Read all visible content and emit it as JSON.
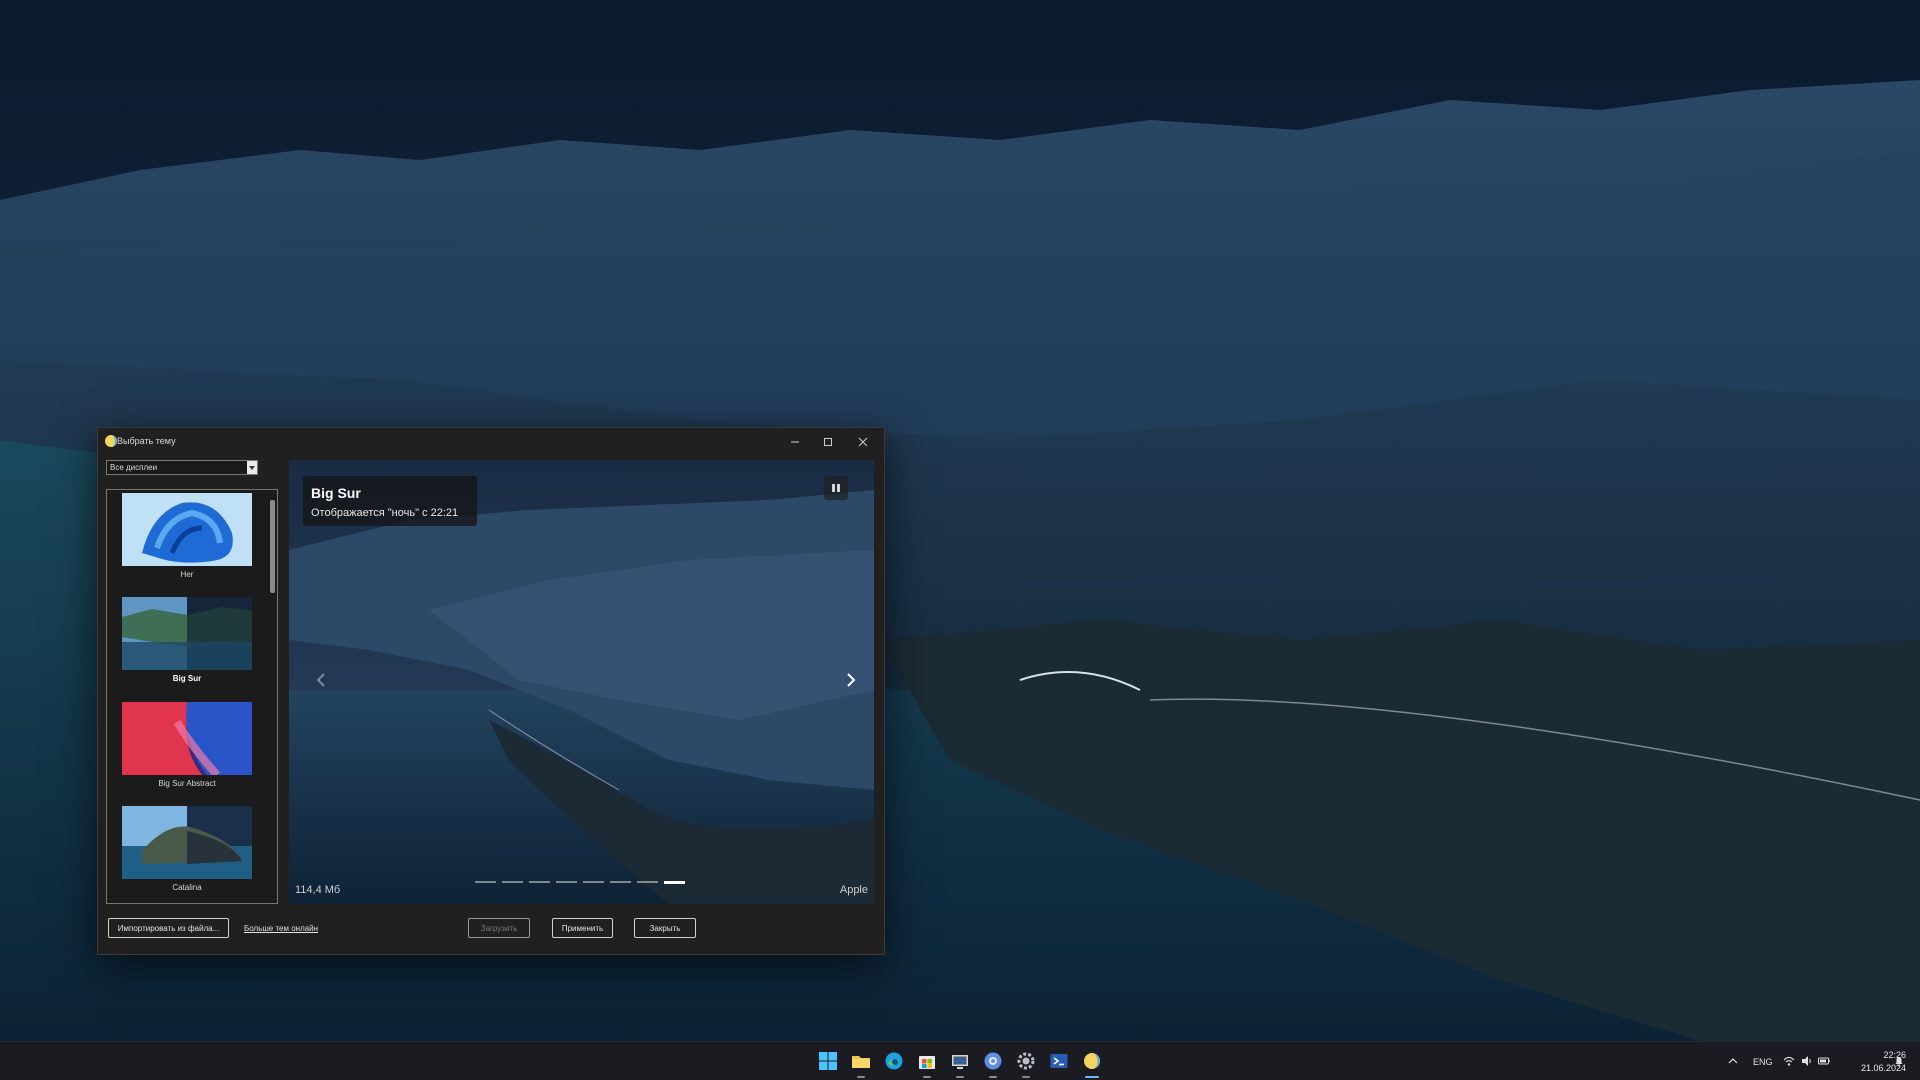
{
  "window": {
    "title": "Выбрать тему",
    "display_select": "Все дисплеи"
  },
  "themes": [
    {
      "label": "Her",
      "selected": false
    },
    {
      "label": "Big Sur",
      "selected": true
    },
    {
      "label": "Big Sur Abstract",
      "selected": false
    },
    {
      "label": "Catalina",
      "selected": false
    }
  ],
  "preview": {
    "title": "Big Sur",
    "subtitle": "Отображается \"ночь\" с 22:21",
    "size": "114,4 Мб",
    "author": "Apple",
    "slides_total": 8,
    "slide_active": 8
  },
  "buttons": {
    "import": "Импортировать из файла...",
    "more_online": "Больше тем онлайн",
    "download": "Загрузить",
    "apply": "Применить",
    "close": "Закрыть"
  },
  "taskbar": {
    "language": "ENG",
    "time": "22:26",
    "date": "21.06.2024",
    "apps": [
      "start-icon",
      "file-explorer-icon",
      "edge-icon",
      "store-icon",
      "mail-icon",
      "browser-icon",
      "settings-icon",
      "terminal-icon",
      "wintheme-icon"
    ]
  },
  "colors": {
    "accent": "#6bb8ff",
    "window_bg": "#202020"
  }
}
